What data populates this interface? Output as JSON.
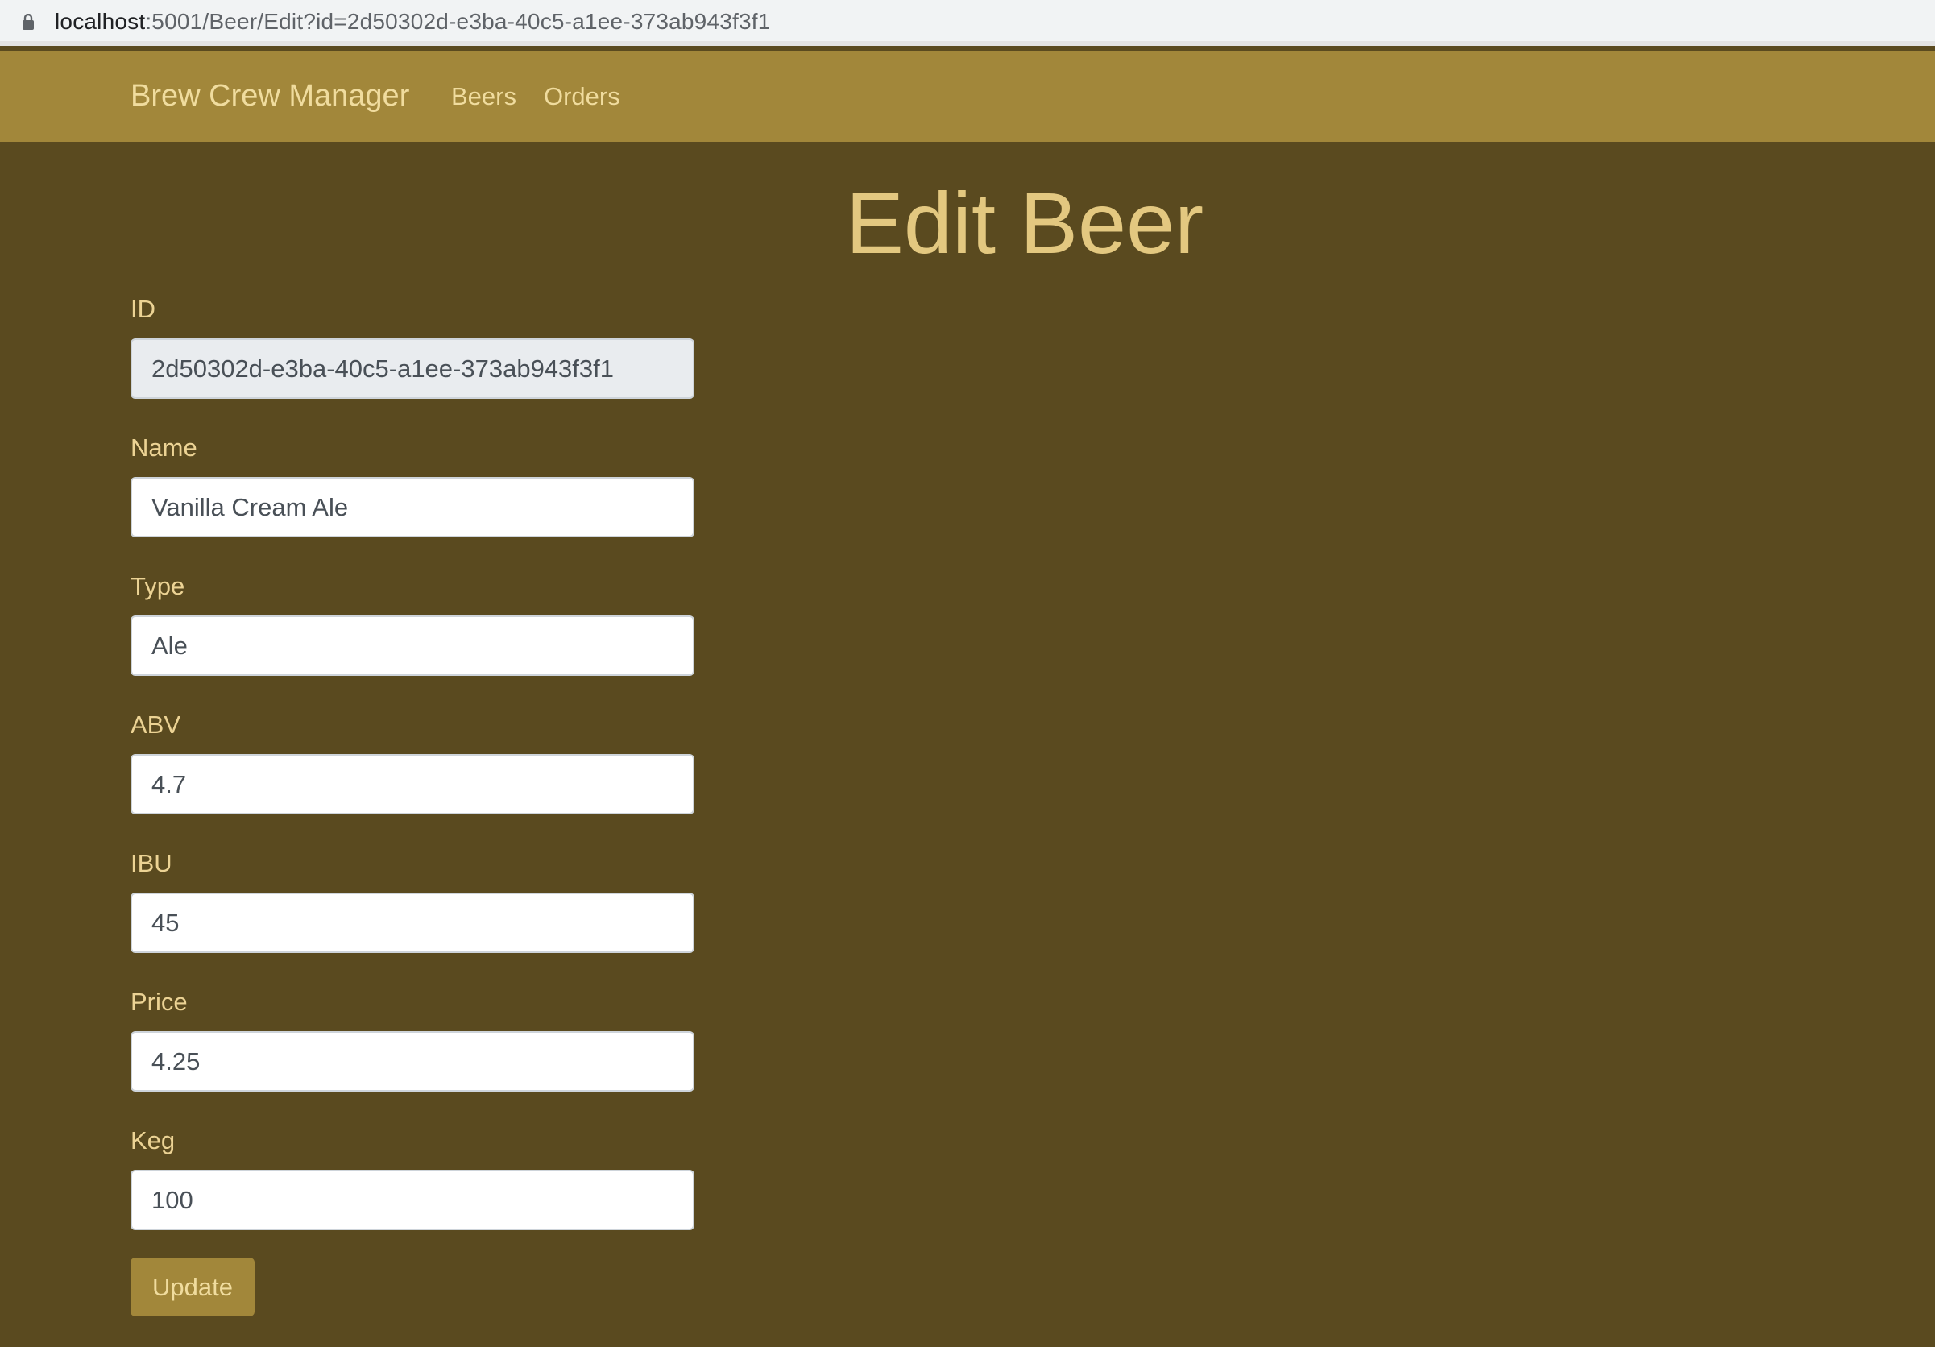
{
  "browser": {
    "url_host": "localhost",
    "url_rest": ":5001/Beer/Edit?id=2d50302d-e3ba-40c5-a1ee-373ab943f3f1"
  },
  "navbar": {
    "brand": "Brew Crew Manager",
    "links": [
      "Beers",
      "Orders"
    ]
  },
  "page": {
    "title": "Edit Beer"
  },
  "form": {
    "fields": [
      {
        "label": "ID",
        "value": "2d50302d-e3ba-40c5-a1ee-373ab943f3f1",
        "readonly": true
      },
      {
        "label": "Name",
        "value": "Vanilla Cream Ale"
      },
      {
        "label": "Type",
        "value": "Ale"
      },
      {
        "label": "ABV",
        "value": "4.7"
      },
      {
        "label": "IBU",
        "value": "45"
      },
      {
        "label": "Price",
        "value": "4.25"
      },
      {
        "label": "Keg",
        "value": "100"
      }
    ],
    "submit_label": "Update"
  },
  "colors": {
    "page_background": "#5a4a1f",
    "navbar_background": "#a2873a",
    "accent_text": "#e3c880",
    "button_background": "#a2873a"
  }
}
